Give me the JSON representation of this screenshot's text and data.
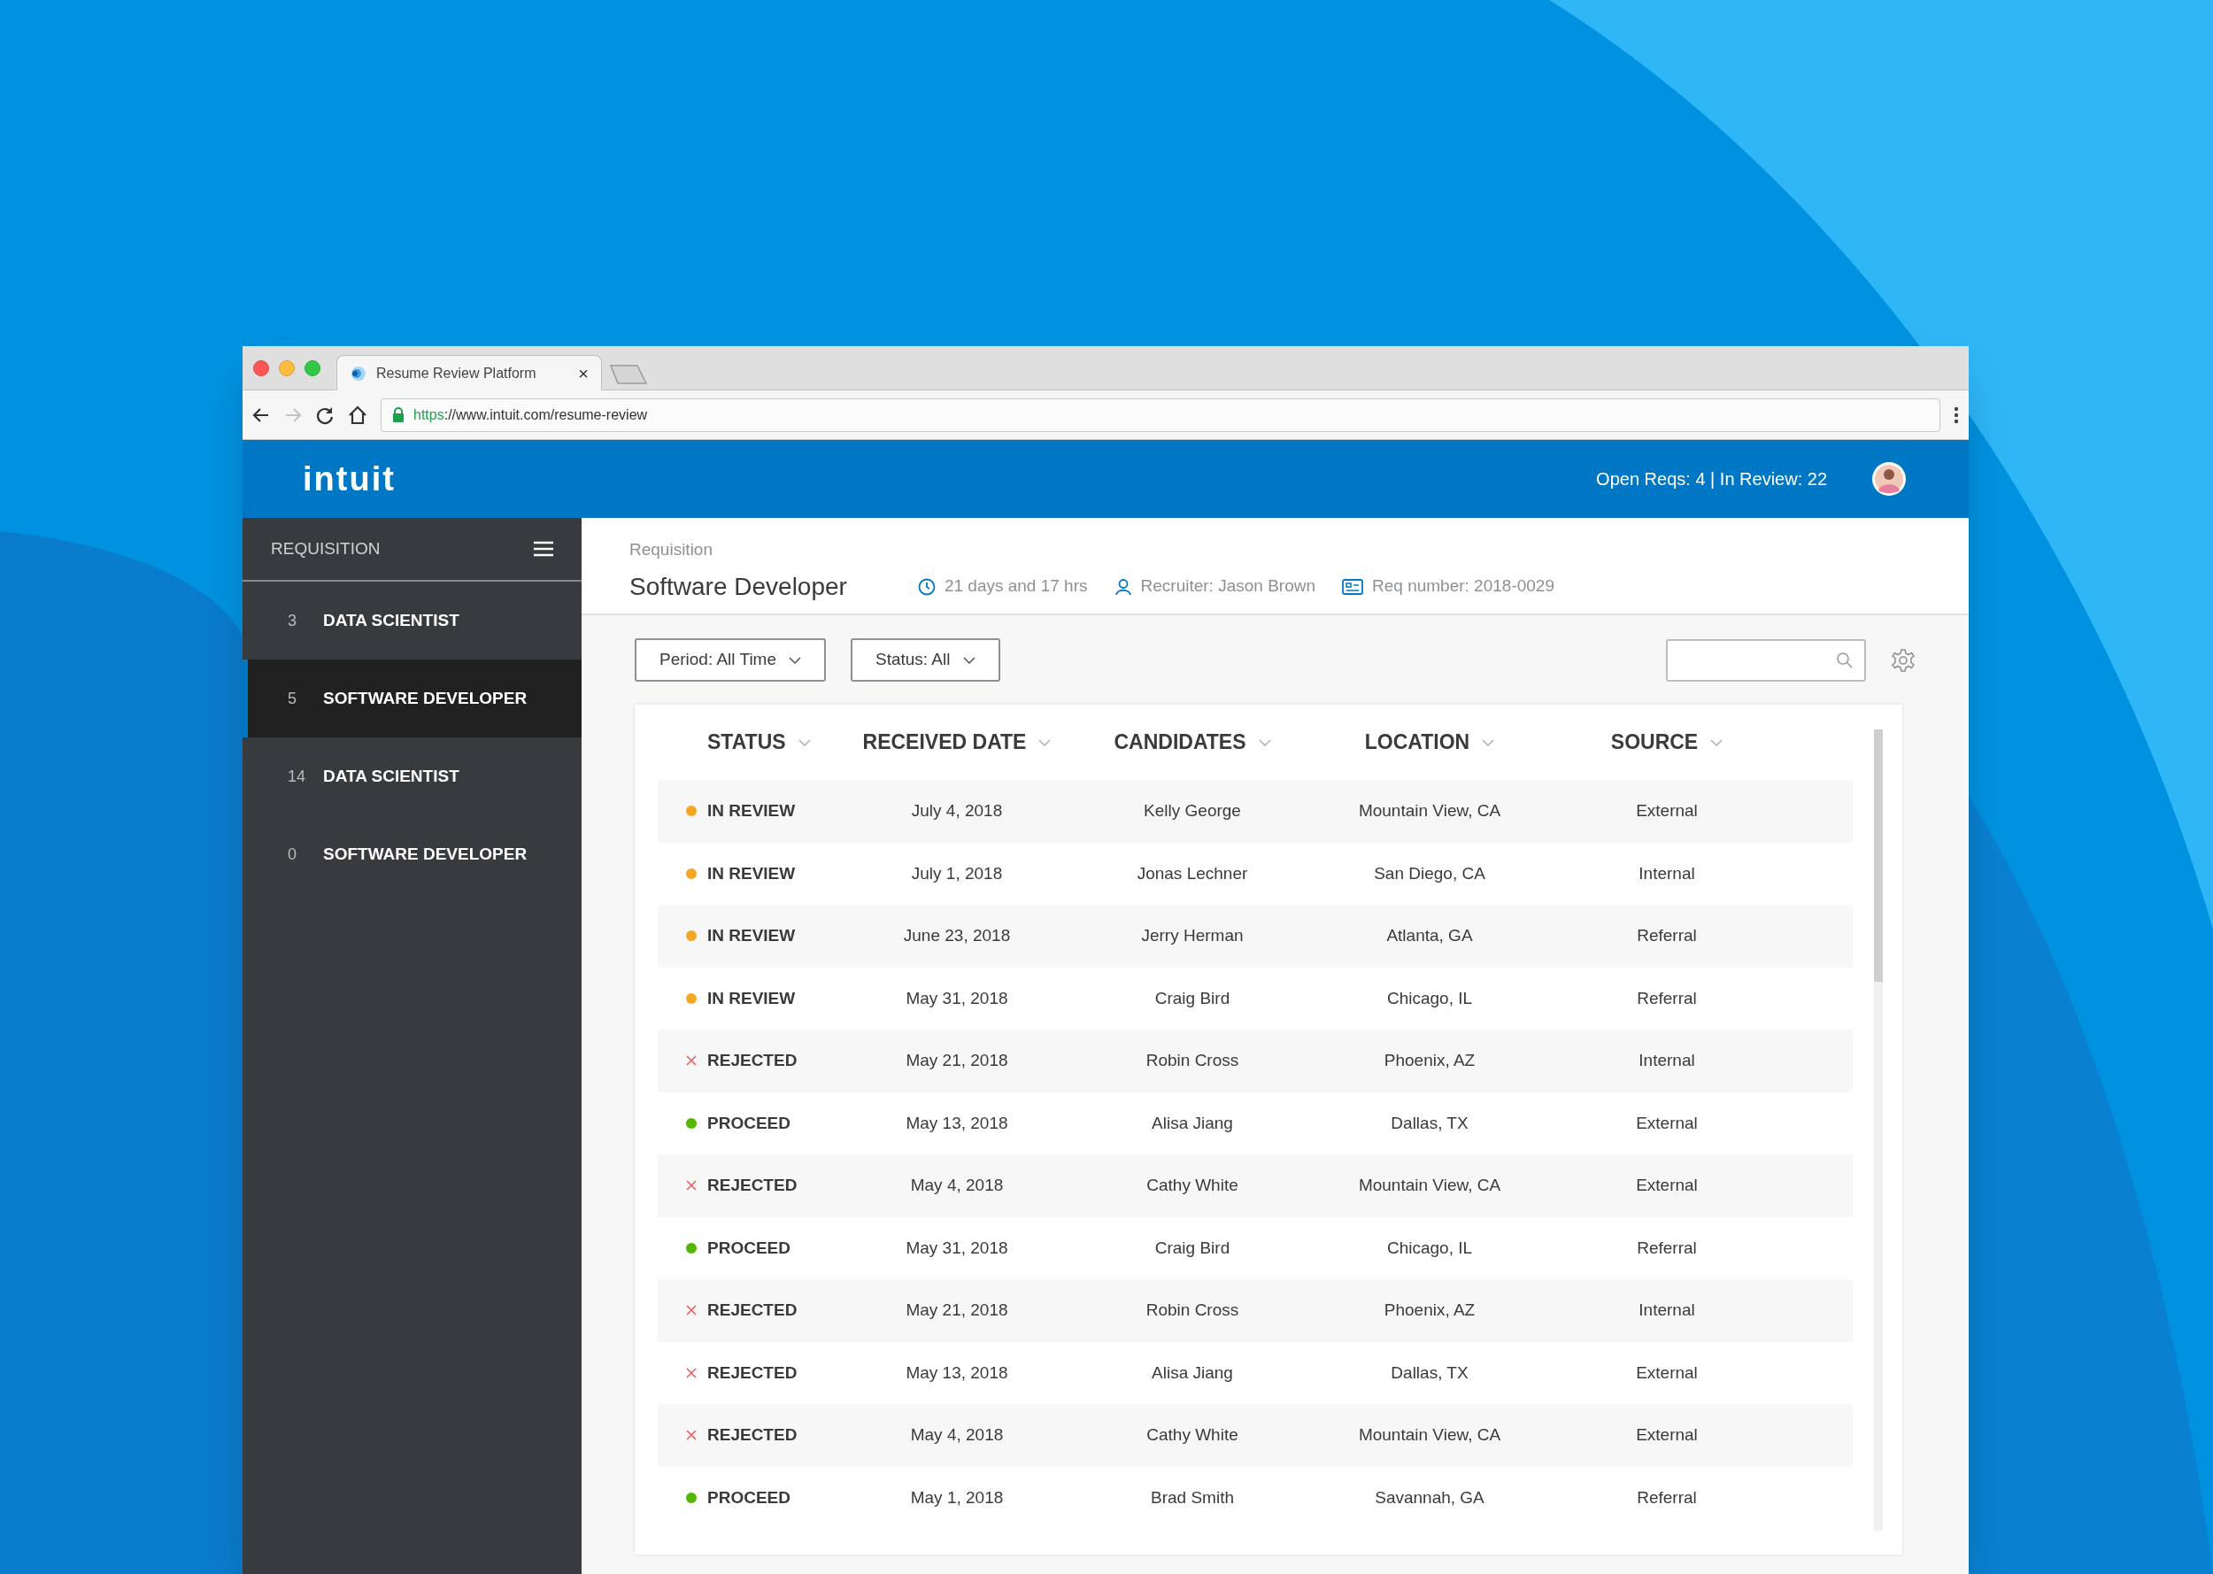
{
  "browser": {
    "tab_title": "Resume Review Platform",
    "tab_close": "×",
    "url_scheme": "https",
    "url_rest": "://www.intuit.com/resume-review"
  },
  "header": {
    "logo": "intuit",
    "stats": "Open Reqs: 4 | In Review: 22"
  },
  "sidebar": {
    "title": "REQUISITION",
    "items": [
      {
        "count": "3",
        "label": "DATA SCIENTIST",
        "selected": false
      },
      {
        "count": "5",
        "label": "SOFTWARE DEVELOPER",
        "selected": true
      },
      {
        "count": "14",
        "label": "DATA SCIENTIST",
        "selected": false
      },
      {
        "count": "0",
        "label": "SOFTWARE DEVELOPER",
        "selected": false
      }
    ]
  },
  "page": {
    "breadcrumb": "Requisition",
    "title": "Software Developer",
    "meta": [
      {
        "kind": "time",
        "text": "21 days and 17 hrs"
      },
      {
        "kind": "recruiter",
        "text": "Recruiter: Jason Brown"
      },
      {
        "kind": "req",
        "text": "Req number: 2018-0029"
      }
    ]
  },
  "filters": [
    "Period: All Time",
    "Status: All"
  ],
  "table": {
    "columns": [
      "STATUS",
      "RECEIVED DATE",
      "CANDIDATES",
      "LOCATION",
      "SOURCE"
    ],
    "rows": [
      {
        "kind": "review",
        "status": "IN REVIEW",
        "date": "July 4, 2018",
        "candidate": "Kelly George",
        "location": "Mountain View, CA",
        "source": "External"
      },
      {
        "kind": "review",
        "status": "IN REVIEW",
        "date": "July 1, 2018",
        "candidate": "Jonas Lechner",
        "location": "San Diego, CA",
        "source": "Internal"
      },
      {
        "kind": "review",
        "status": "IN REVIEW",
        "date": "June 23, 2018",
        "candidate": "Jerry Herman",
        "location": "Atlanta, GA",
        "source": "Referral"
      },
      {
        "kind": "review",
        "status": "IN REVIEW",
        "date": "May 31, 2018",
        "candidate": "Craig Bird",
        "location": "Chicago, IL",
        "source": "Referral"
      },
      {
        "kind": "rejected",
        "status": "REJECTED",
        "date": "May 21, 2018",
        "candidate": "Robin Cross",
        "location": "Phoenix, AZ",
        "source": "Internal"
      },
      {
        "kind": "proceed",
        "status": "PROCEED",
        "date": "May 13, 2018",
        "candidate": "Alisa Jiang",
        "location": "Dallas, TX",
        "source": "External"
      },
      {
        "kind": "rejected",
        "status": "REJECTED",
        "date": "May 4, 2018",
        "candidate": "Cathy White",
        "location": "Mountain View, CA",
        "source": "External"
      },
      {
        "kind": "proceed",
        "status": "PROCEED",
        "date": "May 31, 2018",
        "candidate": "Craig Bird",
        "location": "Chicago, IL",
        "source": "Referral"
      },
      {
        "kind": "rejected",
        "status": "REJECTED",
        "date": "May 21, 2018",
        "candidate": "Robin Cross",
        "location": "Phoenix, AZ",
        "source": "Internal"
      },
      {
        "kind": "rejected",
        "status": "REJECTED",
        "date": "May 13, 2018",
        "candidate": "Alisa Jiang",
        "location": "Dallas, TX",
        "source": "External"
      },
      {
        "kind": "rejected",
        "status": "REJECTED",
        "date": "May 4, 2018",
        "candidate": "Cathy White",
        "location": "Mountain View, CA",
        "source": "External"
      },
      {
        "kind": "proceed",
        "status": "PROCEED",
        "date": "May 1, 2018",
        "candidate": "Brad Smith",
        "location": "Savannah, GA",
        "source": "Referral"
      }
    ]
  }
}
